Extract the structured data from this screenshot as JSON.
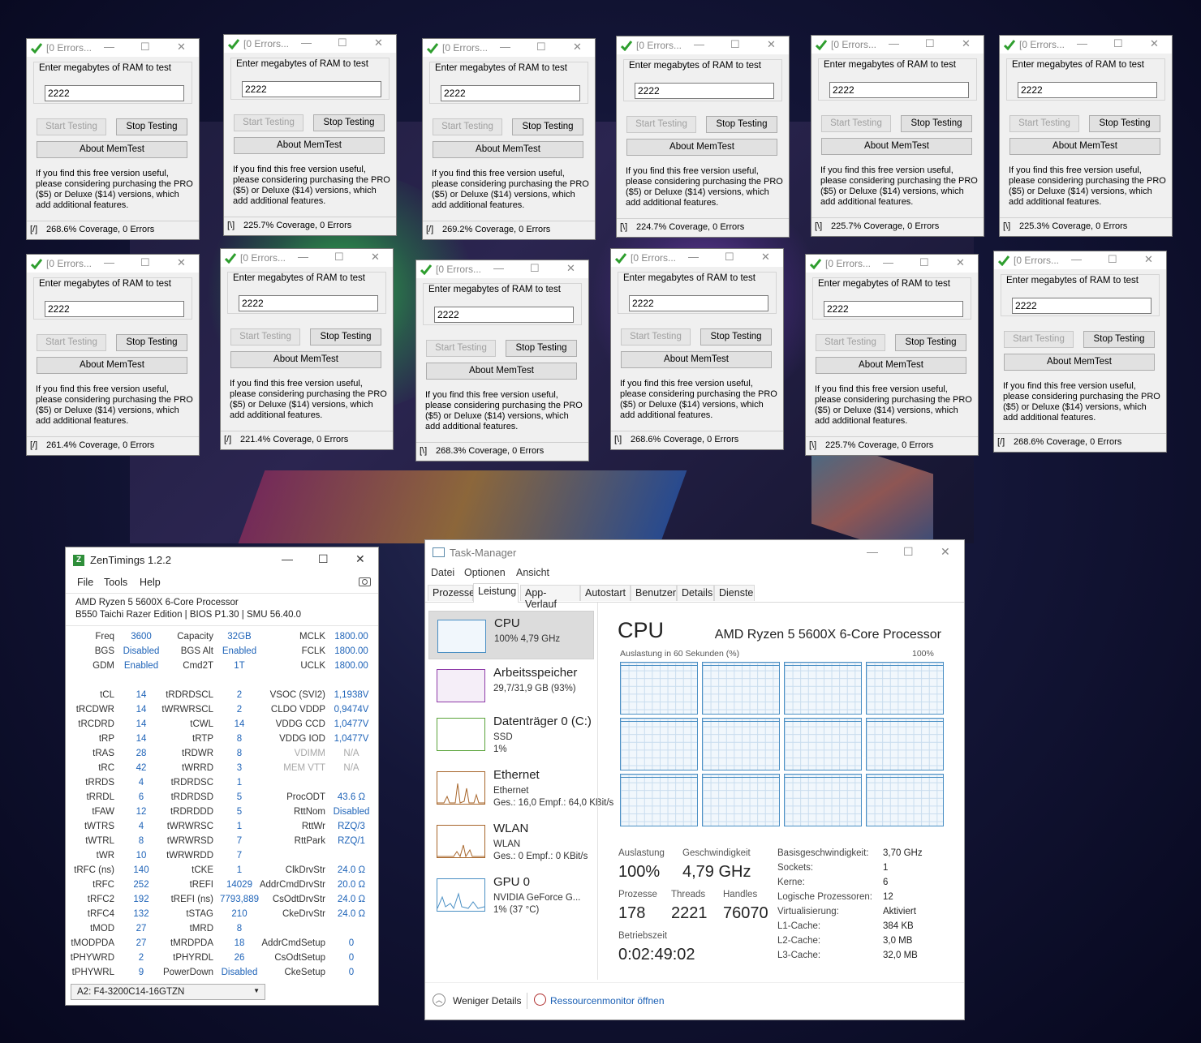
{
  "memtest": {
    "title": "[0 Errors...",
    "ram_label": "Enter megabytes of RAM to test",
    "ram_value": "2222",
    "start_label": "Start Testing",
    "stop_label": "Stop Testing",
    "about_label": "About MemTest",
    "info_lines": [
      "If you find this free version useful,",
      "please considering purchasing the PRO",
      "($5) or Deluxe ($14) versions, which",
      "add additional features."
    ],
    "windows": [
      {
        "spinner": "[/]",
        "status": "268.6% Coverage, 0 Errors"
      },
      {
        "spinner": "[\\]",
        "status": "225.7% Coverage, 0 Errors"
      },
      {
        "spinner": "[/]",
        "status": "269.2% Coverage, 0 Errors"
      },
      {
        "spinner": "[\\]",
        "status": "224.7% Coverage, 0 Errors"
      },
      {
        "spinner": "[\\]",
        "status": "225.7% Coverage, 0 Errors"
      },
      {
        "spinner": "[\\]",
        "status": "225.3% Coverage, 0 Errors"
      },
      {
        "spinner": "[/]",
        "status": "261.4% Coverage, 0 Errors"
      },
      {
        "spinner": "[/]",
        "status": "221.4% Coverage, 0 Errors"
      },
      {
        "spinner": "[\\]",
        "status": "268.3% Coverage, 0 Errors"
      },
      {
        "spinner": "[\\]",
        "status": "268.6% Coverage, 0 Errors"
      },
      {
        "spinner": "[\\]",
        "status": "225.7% Coverage, 0 Errors"
      },
      {
        "spinner": "[/]",
        "status": "268.6% Coverage, 0 Errors"
      }
    ]
  },
  "zentimings": {
    "title": "ZenTimings 1.2.2",
    "menu": [
      "File",
      "Tools",
      "Help"
    ],
    "cpu": "AMD Ryzen 5 5600X 6-Core Processor",
    "bios": "B550 Taichi Razer Edition | BIOS P1.30 | SMU 56.40.0",
    "col1": [
      [
        "Freq",
        "3600"
      ],
      [
        "BGS",
        "Disabled"
      ],
      [
        "GDM",
        "Enabled"
      ],
      null,
      [
        "tCL",
        "14"
      ],
      [
        "tRCDWR",
        "14"
      ],
      [
        "tRCDRD",
        "14"
      ],
      [
        "tRP",
        "14"
      ],
      [
        "tRAS",
        "28"
      ],
      [
        "tRC",
        "42"
      ],
      [
        "tRRDS",
        "4"
      ],
      [
        "tRRDL",
        "6"
      ],
      [
        "tFAW",
        "12"
      ],
      [
        "tWTRS",
        "4"
      ],
      [
        "tWTRL",
        "8"
      ],
      [
        "tWR",
        "10"
      ],
      [
        "tRFC (ns)",
        "140"
      ],
      [
        "tRFC",
        "252"
      ],
      [
        "tRFC2",
        "192"
      ],
      [
        "tRFC4",
        "132"
      ],
      [
        "tMOD",
        "27"
      ],
      [
        "tMODPDA",
        "27"
      ],
      [
        "tPHYWRD",
        "2"
      ],
      [
        "tPHYWRL",
        "9"
      ]
    ],
    "col2": [
      [
        "Capacity",
        "32GB"
      ],
      [
        "BGS Alt",
        "Enabled"
      ],
      [
        "Cmd2T",
        "1T"
      ],
      null,
      [
        "tRDRDSCL",
        "2"
      ],
      [
        "tWRWRSCL",
        "2"
      ],
      [
        "tCWL",
        "14"
      ],
      [
        "tRTP",
        "8"
      ],
      [
        "tRDWR",
        "8"
      ],
      [
        "tWRRD",
        "3"
      ],
      [
        "tRDRDSC",
        "1"
      ],
      [
        "tRDRDSD",
        "5"
      ],
      [
        "tRDRDDD",
        "5"
      ],
      [
        "tWRWRSC",
        "1"
      ],
      [
        "tWRWRSD",
        "7"
      ],
      [
        "tWRWRDD",
        "7"
      ],
      [
        "tCKE",
        "1"
      ],
      [
        "tREFI",
        "14029"
      ],
      [
        "tREFI (ns)",
        "7793,889"
      ],
      [
        "tSTAG",
        "210"
      ],
      [
        "tMRD",
        "8"
      ],
      [
        "tMRDPDA",
        "18"
      ],
      [
        "tPHYRDL",
        "26"
      ],
      [
        "PowerDown",
        "Disabled"
      ]
    ],
    "col3": [
      [
        "MCLK",
        "1800.00"
      ],
      [
        "FCLK",
        "1800.00"
      ],
      [
        "UCLK",
        "1800.00"
      ],
      null,
      [
        "VSOC (SVI2)",
        "1,1938V"
      ],
      [
        "CLDO VDDP",
        "0,9474V"
      ],
      [
        "VDDG CCD",
        "1,0477V"
      ],
      [
        "VDDG IOD",
        "1,0477V"
      ],
      [
        "VDIMM",
        "N/A"
      ],
      [
        "MEM VTT",
        "N/A"
      ],
      null,
      [
        "ProcODT",
        "43.6 Ω"
      ],
      [
        "RttNom",
        "Disabled"
      ],
      [
        "RttWr",
        "RZQ/3"
      ],
      [
        "RttPark",
        "RZQ/1"
      ],
      null,
      [
        "ClkDrvStr",
        "24.0 Ω"
      ],
      [
        "AddrCmdDrvStr",
        "20.0 Ω"
      ],
      [
        "CsOdtDrvStr",
        "24.0 Ω"
      ],
      [
        "CkeDrvStr",
        "24.0 Ω"
      ],
      null,
      [
        "AddrCmdSetup",
        "0"
      ],
      [
        "CsOdtSetup",
        "0"
      ],
      [
        "CkeSetup",
        "0"
      ]
    ],
    "dimm": "A2: F4-3200C14-16GTZN"
  },
  "taskmanager": {
    "title": "Task-Manager",
    "menu": [
      "Datei",
      "Optionen",
      "Ansicht"
    ],
    "tabs": [
      "Prozesse",
      "Leistung",
      "App-Verlauf",
      "Autostart",
      "Benutzer",
      "Details",
      "Dienste"
    ],
    "side": [
      {
        "name": "CPU",
        "s1": "100% 4,79 GHz",
        "s2": ""
      },
      {
        "name": "Arbeitsspeicher",
        "s1": "29,7/31,9 GB (93%)",
        "s2": ""
      },
      {
        "name": "Datenträger 0 (C:)",
        "s1": "SSD",
        "s2": "1%"
      },
      {
        "name": "Ethernet",
        "s1": "Ethernet",
        "s2": "Ges.: 16,0  Empf.: 64,0 KBit/s"
      },
      {
        "name": "WLAN",
        "s1": "WLAN",
        "s2": "Ges.: 0  Empf.: 0 KBit/s"
      },
      {
        "name": "GPU 0",
        "s1": "NVIDIA GeForce G...",
        "s2": "1% (37 °C)"
      }
    ],
    "heading": "CPU",
    "processor": "AMD Ryzen 5 5600X 6-Core Processor",
    "graph_label": "Auslastung in 60 Sekunden (%)",
    "graph_max": "100%",
    "stats": {
      "util_label": "Auslastung",
      "util": "100%",
      "speed_label": "Geschwindigkeit",
      "speed": "4,79 GHz",
      "proc_label": "Prozesse",
      "proc": "178",
      "threads_label": "Threads",
      "threads": "2221",
      "handles_label": "Handles",
      "handles": "76070",
      "uptime_label": "Betriebszeit",
      "uptime": "0:02:49:02"
    },
    "specs": [
      [
        "Basisgeschwindigkeit:",
        "3,70 GHz"
      ],
      [
        "Sockets:",
        "1"
      ],
      [
        "Kerne:",
        "6"
      ],
      [
        "Logische Prozessoren:",
        "12"
      ],
      [
        "Virtualisierung:",
        "Aktiviert"
      ],
      [
        "L1-Cache:",
        "384 KB"
      ],
      [
        "L2-Cache:",
        "3,0 MB"
      ],
      [
        "L3-Cache:",
        "32,0 MB"
      ]
    ],
    "footer_less": "Weniger Details",
    "footer_link": "Ressourcenmonitor öffnen"
  }
}
